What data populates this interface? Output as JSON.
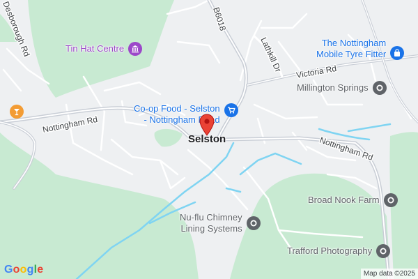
{
  "map": {
    "colors": {
      "land": "#eef0f2",
      "park": "#c8ead2",
      "road": "#ffffff",
      "major_road": "#c9ced6",
      "water": "#7fd4f2",
      "poi_purple": "#9c47c9",
      "poi_blue": "#1a73e8",
      "poi_gray": "#5f6368",
      "poi_orange": "#f39c34",
      "pin_red": "#ea4335"
    },
    "place_label": "Selston",
    "road_labels": {
      "nottingham_rd_west": "Nottingham Rd",
      "nottingham_rd_east": "Nottingham Rd",
      "b6018": "B6018",
      "lathkill_dr": "Lathkill Dr",
      "victoria_rd": "Victoria Rd",
      "desborough_rd": "Desborough Rd"
    },
    "pois": {
      "tin_hat": {
        "name": "Tin Hat Centre",
        "icon": "landmark-icon"
      },
      "coop": {
        "line1": "Co-op Food - Selston",
        "line2": "- Nottingham Road",
        "icon": "shopping-cart-icon"
      },
      "tyre": {
        "line1": "The Nottingham",
        "line2": "Mobile Tyre Fitter",
        "icon": "shopping-bag-icon"
      },
      "millington": {
        "name": "Millington Springs",
        "icon": "place-icon"
      },
      "broad_nook": {
        "name": "Broad Nook Farm",
        "icon": "place-icon"
      },
      "nuflu": {
        "line1": "Nu-flu Chimney",
        "line2": "Lining Systems",
        "icon": "place-icon"
      },
      "trafford": {
        "name": "Trafford Photography",
        "icon": "place-icon"
      },
      "bar": {
        "icon": "cocktail-icon"
      }
    },
    "branding": {
      "logo_letters": [
        "G",
        "o",
        "o",
        "g",
        "l",
        "e"
      ],
      "logo_colors": [
        "#4285f4",
        "#ea4335",
        "#fbbc05",
        "#4285f4",
        "#34a853",
        "#ea4335"
      ]
    },
    "attribution": "Map data ©2025"
  }
}
